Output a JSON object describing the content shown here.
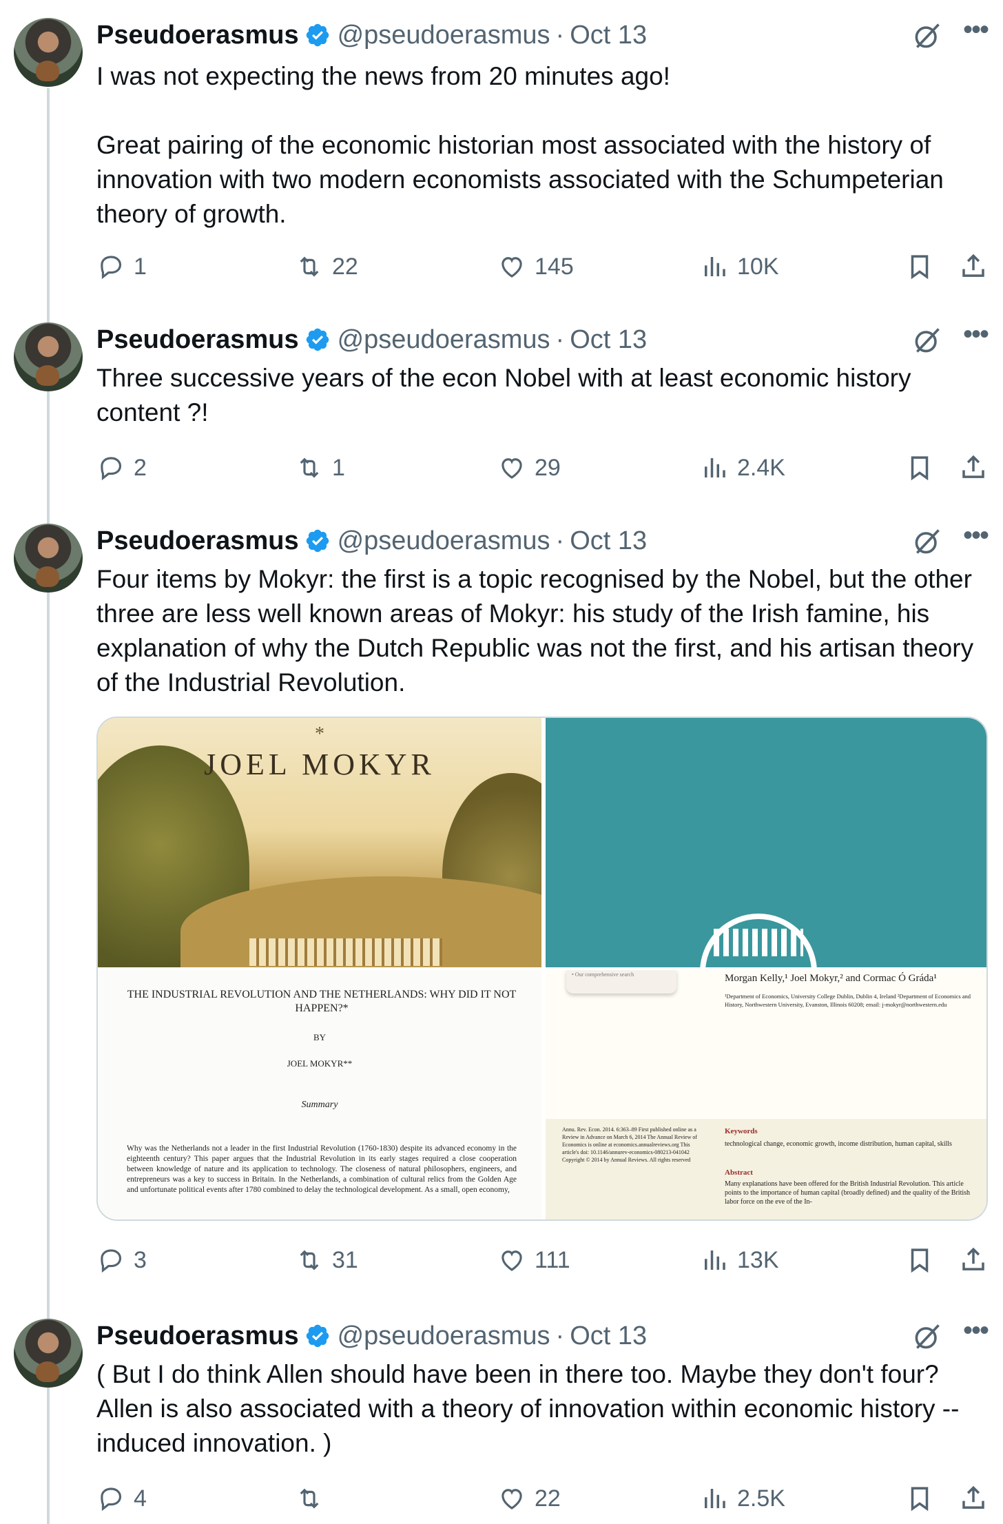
{
  "author": {
    "name": "Pseudoerasmus",
    "handle": "@pseudoerasmus",
    "separator": "·"
  },
  "colors": {
    "text": "#0f1419",
    "secondary": "#536471",
    "verified": "#1d9bf0",
    "thread_line": "#cfd9de"
  },
  "tweets": [
    {
      "date": "Oct 13",
      "text": "I was not expecting the news from 20 minutes ago!\n\nGreat pairing of the economic historian most associated with the history of innovation with two modern economists associated with the Schumpeterian theory of growth.",
      "replies": "1",
      "reposts": "22",
      "likes": "145",
      "views": "10K"
    },
    {
      "date": "Oct 13",
      "text": "Three successive years of the econ Nobel with at least economic history content ?!",
      "replies": "2",
      "reposts": "1",
      "likes": "29",
      "views": "2.4K"
    },
    {
      "date": "Oct 13",
      "text": "Four items by Mokyr: the first is a topic recognised by the Nobel, but the other three are less well known areas of Mokyr: his study of the Irish famine, his explanation of why the Dutch Republic was not the first, and his artisan theory of the Industrial Revolution.",
      "replies": "3",
      "reposts": "31",
      "likes": "111",
      "views": "13K",
      "media": {
        "book_cover": {
          "star": "*",
          "author": "JOEL MOKYR"
        },
        "paper": {
          "title": "THE INDUSTRIAL REVOLUTION AND THE NETHERLANDS: WHY DID IT NOT HAPPEN?*",
          "by": "BY",
          "author": "JOEL MOKYR**",
          "summary_heading": "Summary",
          "abstract": "Why was the Netherlands not a leader in the first Industrial Revolution (1760-1830) despite its advanced economy in the eighteenth century? This paper argues that the Industrial Revolution in its early stages required a close cooperation between knowledge of nature and its application to technology. The closeness of natural philosophers, engineers, and entrepreneurs was a key to success in Britain. In the Netherlands, a combination of cultural relics from the Golden Age and unfortunate political events after 1780 combined to delay the technological development. As a small, open economy,"
        },
        "review": {
          "search_card": "• Our comprehensive search",
          "authors": "Morgan Kelly,¹ Joel Mokyr,² and Cormac Ó Gráda¹",
          "affiliations": "¹Department of Economics, University College Dublin, Dublin 4, Ireland ²Department of Economics and History, Northwestern University, Evanston, Illinois 60208; email: j-mokyr@northwestern.edu",
          "meta": "Annu. Rev. Econ. 2014. 6:363–89 First published online as a Review in Advance on March 6, 2014 The Annual Review of Economics is online at economics.annualreviews.org This article's doi: 10.1146/annurev-economics-080213-041042 Copyright © 2014 by Annual Reviews. All rights reserved",
          "keywords_heading": "Keywords",
          "keywords": "technological change, economic growth, income distribution, human capital, skills",
          "abstract_heading": "Abstract",
          "abstract": "Many explanations have been offered for the British Industrial Revolution. This article points to the importance of human capital (broadly defined) and the quality of the British labor force on the eve of the In-"
        }
      }
    },
    {
      "date": "Oct 13",
      "text": "( But I do think Allen should have been in there too. Maybe they don't four? Allen is also associated with a theory of innovation within economic history -- induced innovation. )",
      "replies": "4",
      "reposts": "",
      "likes": "22",
      "views": "2.5K"
    }
  ],
  "icons": [
    "verified-badge-icon",
    "grok-icon",
    "more-icon",
    "reply-icon",
    "repost-icon",
    "like-icon",
    "views-icon",
    "bookmark-icon",
    "share-icon"
  ]
}
